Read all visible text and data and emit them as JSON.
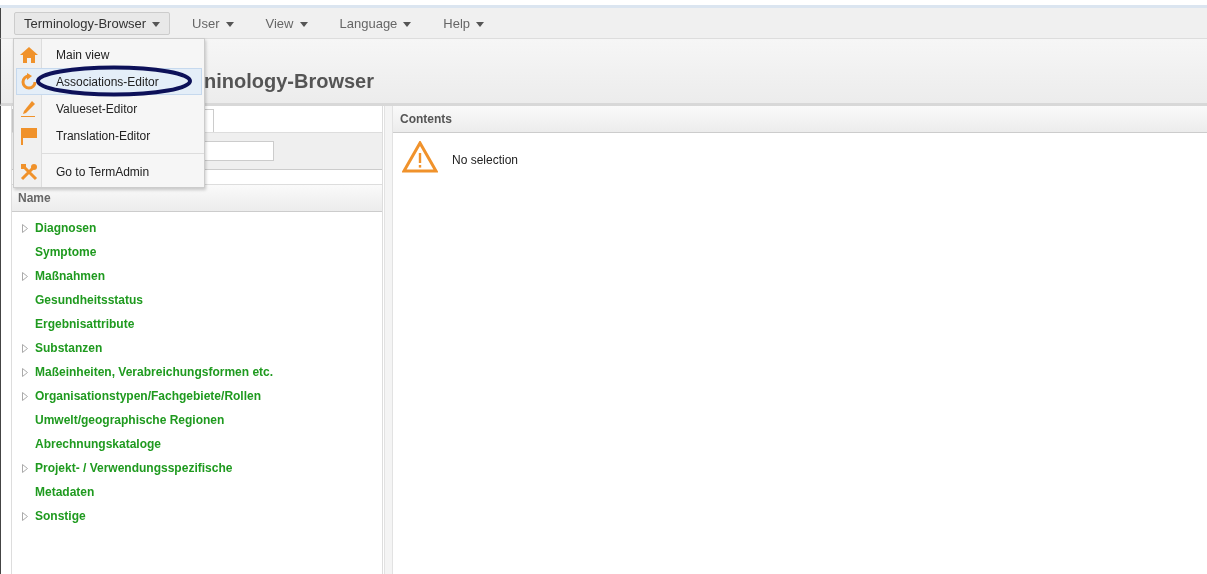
{
  "menubar": [
    {
      "label": "Terminology-Browser",
      "selected": true
    },
    {
      "label": "User",
      "selected": false
    },
    {
      "label": "View",
      "selected": false
    },
    {
      "label": "Language",
      "selected": false
    },
    {
      "label": "Help",
      "selected": false
    }
  ],
  "dropdown": {
    "items": [
      {
        "label": "Main view",
        "selected": false,
        "circled": false,
        "divider_before": false
      },
      {
        "label": "Associations-Editor",
        "selected": true,
        "circled": true,
        "divider_before": false
      },
      {
        "label": "Valueset-Editor",
        "selected": false,
        "circled": false,
        "divider_before": false
      },
      {
        "label": "Translation-Editor",
        "selected": false,
        "circled": false,
        "divider_before": false
      },
      {
        "label": "Go to TermAdmin",
        "selected": false,
        "circled": false,
        "divider_before": true
      }
    ]
  },
  "header": {
    "title": "ninology-Browser"
  },
  "left_panel": {
    "column": "Name",
    "tree": [
      {
        "label": "Diagnosen",
        "expandable": true
      },
      {
        "label": "Symptome",
        "expandable": false
      },
      {
        "label": "Maßnahmen",
        "expandable": true
      },
      {
        "label": "Gesundheitsstatus",
        "expandable": false
      },
      {
        "label": "Ergebnisattribute",
        "expandable": false
      },
      {
        "label": "Substanzen",
        "expandable": true
      },
      {
        "label": "Maßeinheiten, Verabreichungsformen etc.",
        "expandable": true
      },
      {
        "label": "Organisationstypen/Fachgebiete/Rollen",
        "expandable": true
      },
      {
        "label": "Umwelt/geographische Regionen",
        "expandable": false
      },
      {
        "label": "Abrechnungskataloge",
        "expandable": false
      },
      {
        "label": "Projekt- / Verwendungsspezifische",
        "expandable": true
      },
      {
        "label": "Metadaten",
        "expandable": false
      },
      {
        "label": "Sonstige",
        "expandable": true
      }
    ]
  },
  "right_panel": {
    "title": "Contents",
    "message": "No selection"
  }
}
